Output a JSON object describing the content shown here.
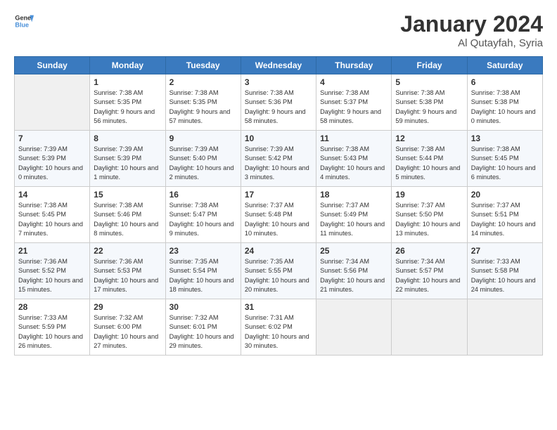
{
  "header": {
    "logo_line1": "General",
    "logo_line2": "Blue",
    "month": "January 2024",
    "location": "Al Qutayfah, Syria"
  },
  "days_of_week": [
    "Sunday",
    "Monday",
    "Tuesday",
    "Wednesday",
    "Thursday",
    "Friday",
    "Saturday"
  ],
  "weeks": [
    [
      {
        "num": "",
        "sunrise": "",
        "sunset": "",
        "daylight": ""
      },
      {
        "num": "1",
        "sunrise": "7:38 AM",
        "sunset": "5:35 PM",
        "daylight": "9 hours and 56 minutes."
      },
      {
        "num": "2",
        "sunrise": "7:38 AM",
        "sunset": "5:35 PM",
        "daylight": "9 hours and 57 minutes."
      },
      {
        "num": "3",
        "sunrise": "7:38 AM",
        "sunset": "5:36 PM",
        "daylight": "9 hours and 58 minutes."
      },
      {
        "num": "4",
        "sunrise": "7:38 AM",
        "sunset": "5:37 PM",
        "daylight": "9 hours and 58 minutes."
      },
      {
        "num": "5",
        "sunrise": "7:38 AM",
        "sunset": "5:38 PM",
        "daylight": "9 hours and 59 minutes."
      },
      {
        "num": "6",
        "sunrise": "7:38 AM",
        "sunset": "5:38 PM",
        "daylight": "10 hours and 0 minutes."
      }
    ],
    [
      {
        "num": "7",
        "sunrise": "7:39 AM",
        "sunset": "5:39 PM",
        "daylight": "10 hours and 0 minutes."
      },
      {
        "num": "8",
        "sunrise": "7:39 AM",
        "sunset": "5:39 PM",
        "daylight": "10 hours and 1 minute."
      },
      {
        "num": "9",
        "sunrise": "7:39 AM",
        "sunset": "5:40 PM",
        "daylight": "10 hours and 2 minutes."
      },
      {
        "num": "10",
        "sunrise": "7:39 AM",
        "sunset": "5:42 PM",
        "daylight": "10 hours and 3 minutes."
      },
      {
        "num": "11",
        "sunrise": "7:38 AM",
        "sunset": "5:43 PM",
        "daylight": "10 hours and 4 minutes."
      },
      {
        "num": "12",
        "sunrise": "7:38 AM",
        "sunset": "5:44 PM",
        "daylight": "10 hours and 5 minutes."
      },
      {
        "num": "13",
        "sunrise": "7:38 AM",
        "sunset": "5:45 PM",
        "daylight": "10 hours and 6 minutes."
      }
    ],
    [
      {
        "num": "14",
        "sunrise": "7:38 AM",
        "sunset": "5:45 PM",
        "daylight": "10 hours and 7 minutes."
      },
      {
        "num": "15",
        "sunrise": "7:38 AM",
        "sunset": "5:46 PM",
        "daylight": "10 hours and 8 minutes."
      },
      {
        "num": "16",
        "sunrise": "7:38 AM",
        "sunset": "5:47 PM",
        "daylight": "10 hours and 9 minutes."
      },
      {
        "num": "17",
        "sunrise": "7:37 AM",
        "sunset": "5:48 PM",
        "daylight": "10 hours and 10 minutes."
      },
      {
        "num": "18",
        "sunrise": "7:37 AM",
        "sunset": "5:49 PM",
        "daylight": "10 hours and 11 minutes."
      },
      {
        "num": "19",
        "sunrise": "7:37 AM",
        "sunset": "5:50 PM",
        "daylight": "10 hours and 13 minutes."
      },
      {
        "num": "20",
        "sunrise": "7:37 AM",
        "sunset": "5:51 PM",
        "daylight": "10 hours and 14 minutes."
      }
    ],
    [
      {
        "num": "21",
        "sunrise": "7:36 AM",
        "sunset": "5:52 PM",
        "daylight": "10 hours and 15 minutes."
      },
      {
        "num": "22",
        "sunrise": "7:36 AM",
        "sunset": "5:53 PM",
        "daylight": "10 hours and 17 minutes."
      },
      {
        "num": "23",
        "sunrise": "7:35 AM",
        "sunset": "5:54 PM",
        "daylight": "10 hours and 18 minutes."
      },
      {
        "num": "24",
        "sunrise": "7:35 AM",
        "sunset": "5:55 PM",
        "daylight": "10 hours and 20 minutes."
      },
      {
        "num": "25",
        "sunrise": "7:34 AM",
        "sunset": "5:56 PM",
        "daylight": "10 hours and 21 minutes."
      },
      {
        "num": "26",
        "sunrise": "7:34 AM",
        "sunset": "5:57 PM",
        "daylight": "10 hours and 22 minutes."
      },
      {
        "num": "27",
        "sunrise": "7:33 AM",
        "sunset": "5:58 PM",
        "daylight": "10 hours and 24 minutes."
      }
    ],
    [
      {
        "num": "28",
        "sunrise": "7:33 AM",
        "sunset": "5:59 PM",
        "daylight": "10 hours and 26 minutes."
      },
      {
        "num": "29",
        "sunrise": "7:32 AM",
        "sunset": "6:00 PM",
        "daylight": "10 hours and 27 minutes."
      },
      {
        "num": "30",
        "sunrise": "7:32 AM",
        "sunset": "6:01 PM",
        "daylight": "10 hours and 29 minutes."
      },
      {
        "num": "31",
        "sunrise": "7:31 AM",
        "sunset": "6:02 PM",
        "daylight": "10 hours and 30 minutes."
      },
      {
        "num": "",
        "sunrise": "",
        "sunset": "",
        "daylight": ""
      },
      {
        "num": "",
        "sunrise": "",
        "sunset": "",
        "daylight": ""
      },
      {
        "num": "",
        "sunrise": "",
        "sunset": "",
        "daylight": ""
      }
    ]
  ]
}
